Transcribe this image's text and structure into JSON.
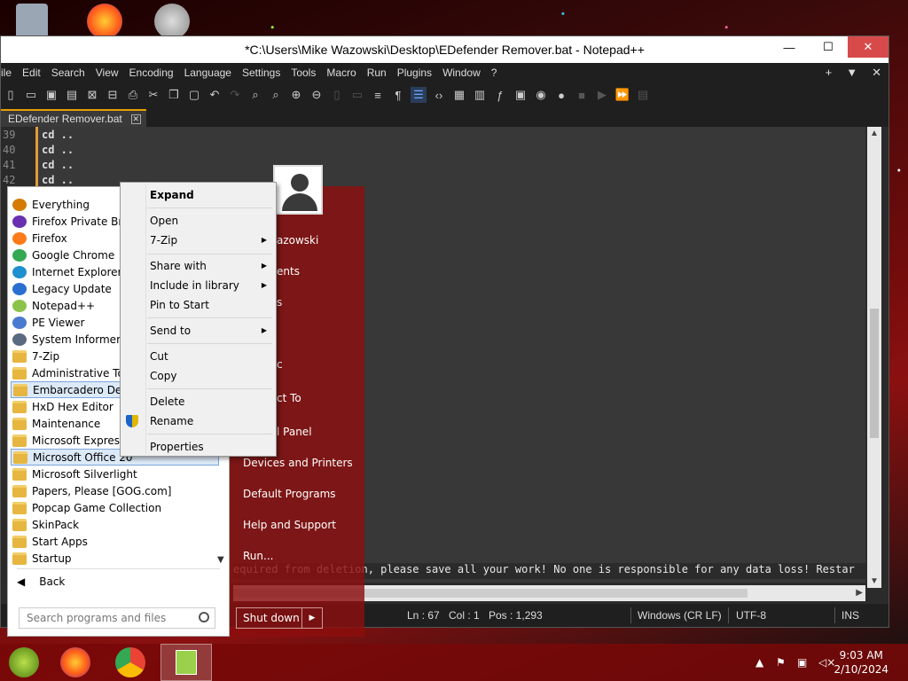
{
  "window": {
    "title": "*C:\\Users\\Mike Wazowski\\Desktop\\EDefender Remover.bat - Notepad++",
    "min": "—",
    "max": "☐",
    "close": "✕"
  },
  "menubar": {
    "items": [
      "ile",
      "Edit",
      "Search",
      "View",
      "Encoding",
      "Language",
      "Settings",
      "Tools",
      "Macro",
      "Run",
      "Plugins",
      "Window",
      "?"
    ],
    "right": [
      "+",
      "▼",
      "✕"
    ]
  },
  "tab": {
    "label": "EDefender Remover.bat",
    "close": "✕"
  },
  "editor": {
    "lines": [
      {
        "num": "39",
        "text": "cd .."
      },
      {
        "num": "40",
        "text": "cd .."
      },
      {
        "num": "41",
        "text": "cd .."
      },
      {
        "num": "42",
        "text": "cd .."
      }
    ],
    "visible_tail": "equired from deletion, please save all your work! No one is responsible for any data loss! Restar"
  },
  "status": {
    "ln": "Ln : 67",
    "col": "Col : 1",
    "pos": "Pos : 1,293",
    "eol": "Windows (CR LF)",
    "encoding": "UTF-8",
    "mode": "INS"
  },
  "start_menu": {
    "programs": [
      {
        "label": "Everything",
        "icon": "everything-icon",
        "color": "#d47b00"
      },
      {
        "label": "Firefox Private Brow",
        "icon": "firefox-private-icon",
        "color": "#6a2fb0"
      },
      {
        "label": "Firefox",
        "icon": "firefox-icon",
        "color": "#ff7a1a"
      },
      {
        "label": "Google Chrome",
        "icon": "chrome-icon",
        "color": "#34a853"
      },
      {
        "label": "Internet Explorer",
        "icon": "ie-icon",
        "color": "#1e90d0"
      },
      {
        "label": "Legacy Update",
        "icon": "legacy-update-icon",
        "color": "#2a6fd0"
      },
      {
        "label": "Notepad++",
        "icon": "notepadpp-icon",
        "color": "#8bc34a"
      },
      {
        "label": "PE Viewer",
        "icon": "pe-viewer-icon",
        "color": "#4a7bd0"
      },
      {
        "label": "System Informer",
        "icon": "system-informer-icon",
        "color": "#5a6a80"
      },
      {
        "label": "7-Zip",
        "icon": "folder-icon",
        "folder": true
      },
      {
        "label": "Administrative Too",
        "icon": "folder-icon",
        "folder": true
      },
      {
        "label": "Embarcadero Dev-C",
        "icon": "folder-icon",
        "folder": true,
        "selected": true
      },
      {
        "label": "HxD Hex Editor",
        "icon": "folder-icon",
        "folder": true
      },
      {
        "label": "Maintenance",
        "icon": "folder-icon",
        "folder": true
      },
      {
        "label": "Microsoft Expressio",
        "icon": "folder-icon",
        "folder": true
      },
      {
        "label": "Microsoft Office 20",
        "icon": "folder-icon",
        "folder": true,
        "selected": true
      },
      {
        "label": "Microsoft Silverlight",
        "icon": "folder-icon",
        "folder": true
      },
      {
        "label": "Papers, Please [GOG.com]",
        "icon": "folder-icon",
        "folder": true
      },
      {
        "label": "Popcap Game Collection",
        "icon": "folder-icon",
        "folder": true
      },
      {
        "label": "SkinPack",
        "icon": "folder-icon",
        "folder": true
      },
      {
        "label": "Start Apps",
        "icon": "folder-icon",
        "folder": true
      },
      {
        "label": "Startup",
        "icon": "folder-icon",
        "folder": true
      }
    ],
    "back": "Back",
    "search_placeholder": "Search programs and files",
    "right_items": [
      "azowski",
      "ents",
      "s",
      "c",
      "ct To",
      "l Panel",
      "Devices and Printers",
      "Default Programs",
      "Help and Support",
      "Run..."
    ],
    "shutdown": "Shut down"
  },
  "context_menu": {
    "items": [
      "Expand",
      "Open",
      "7-Zip",
      "Share with",
      "Include in library",
      "Pin to Start",
      "Send to",
      "Cut",
      "Copy",
      "Delete",
      "Rename",
      "Properties"
    ]
  },
  "taskbar": {
    "time": "9:03 AM",
    "date": "2/10/2024"
  },
  "colors": {
    "npp_dark": "#1f1f1f",
    "start_red": "#8c0f0f",
    "accent_orange": "#e09a3a"
  }
}
